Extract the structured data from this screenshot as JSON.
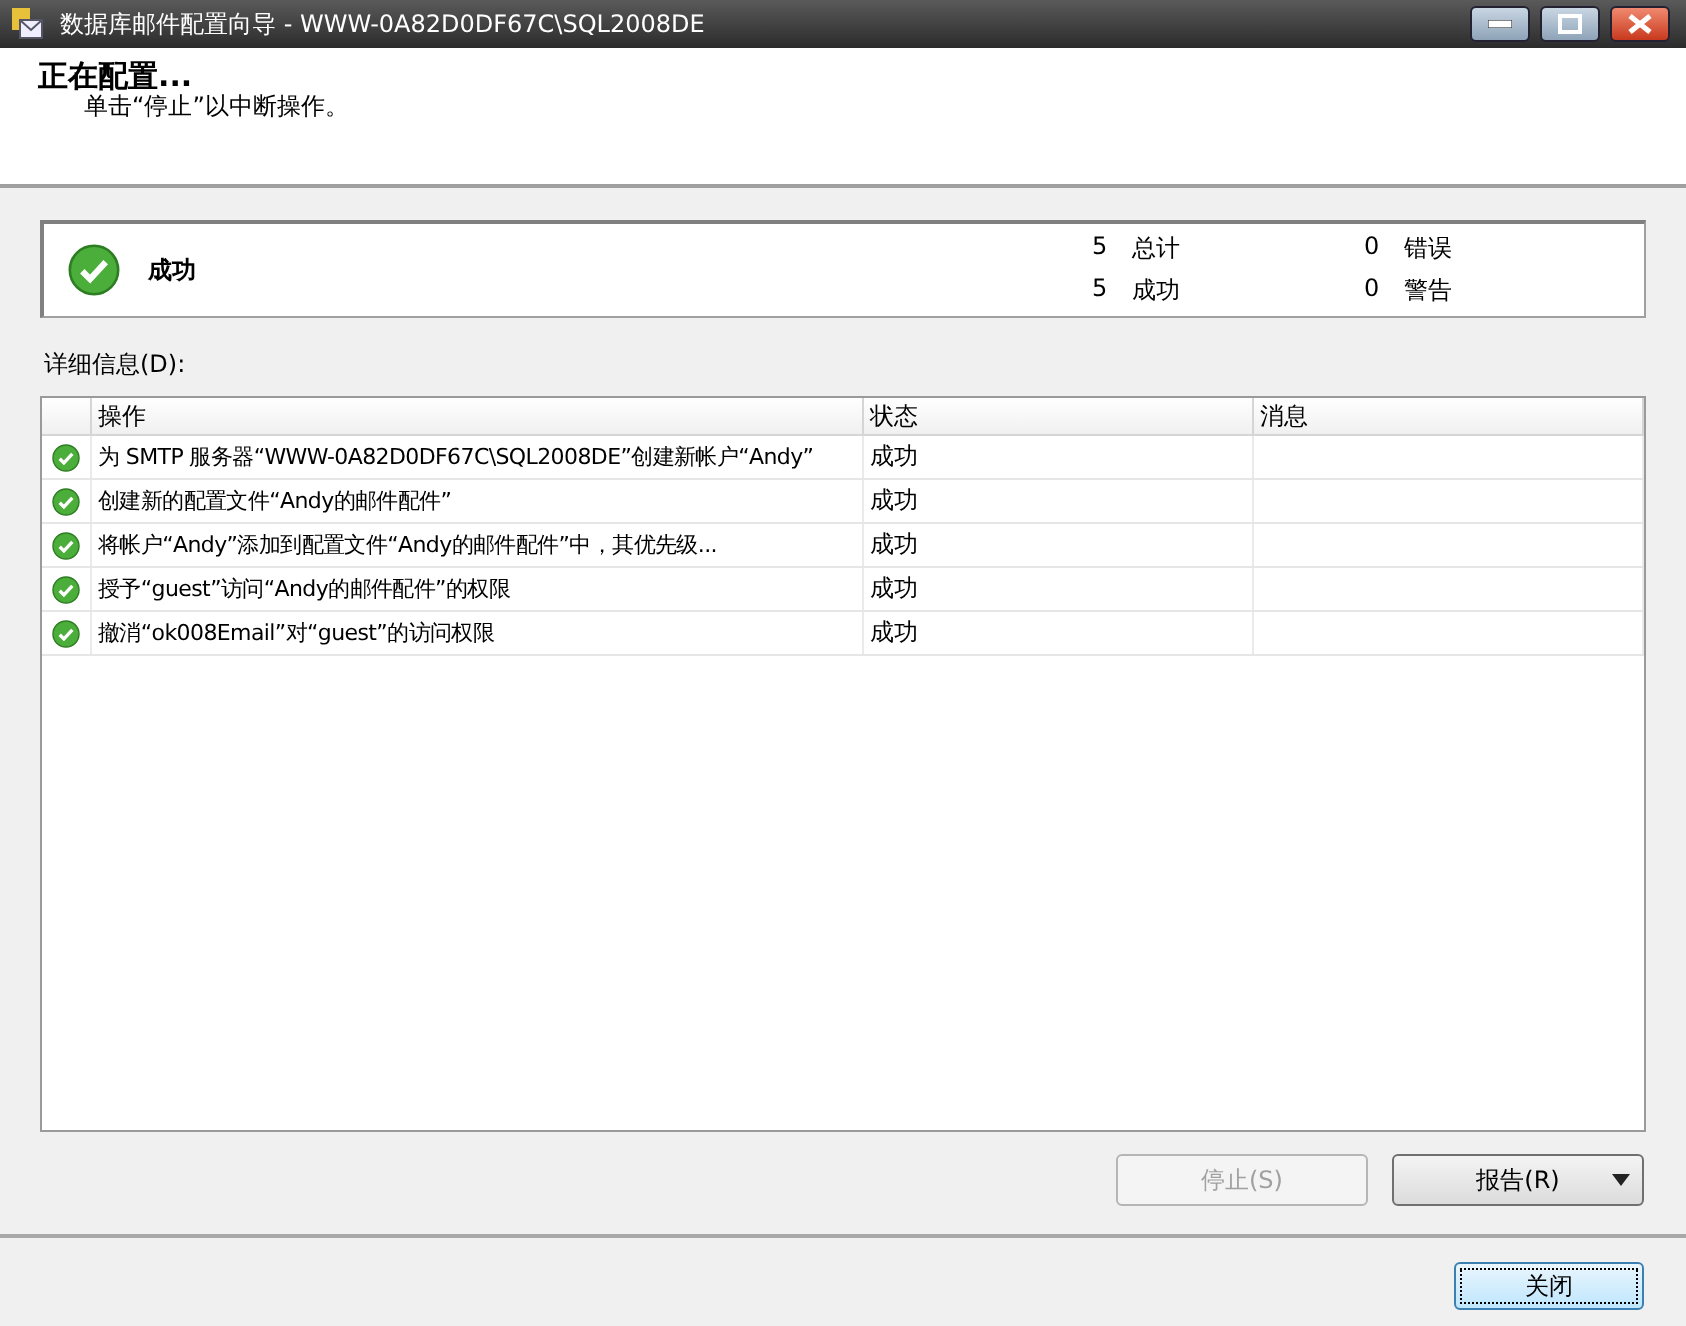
{
  "window": {
    "title": "数据库邮件配置向导 - WWW-0A82D0DF67C\\SQL2008DE"
  },
  "header": {
    "title": "正在配置...",
    "subtitle": "单击“停止”以中断操作。"
  },
  "summary": {
    "status": "成功",
    "stats": [
      {
        "value": "5",
        "label": "总计"
      },
      {
        "value": "0",
        "label": "错误"
      },
      {
        "value": "5",
        "label": "成功"
      },
      {
        "value": "0",
        "label": "警告"
      }
    ]
  },
  "details": {
    "label": "详细信息(D):",
    "columns": [
      "操作",
      "状态",
      "消息"
    ],
    "rows": [
      {
        "action": "为 SMTP 服务器“WWW-0A82D0DF67C\\SQL2008DE”创建新帐户“Andy”",
        "status": "成功"
      },
      {
        "action": "创建新的配置文件“Andy的邮件配件”",
        "status": "成功"
      },
      {
        "action": "将帐户“Andy”添加到配置文件“Andy的邮件配件”中，其优先级...",
        "status": "成功"
      },
      {
        "action": "授予“guest”访问“Andy的邮件配件”的权限",
        "status": "成功"
      },
      {
        "action": "撤消“ok008Email”对“guest”的访问权限",
        "status": "成功"
      }
    ]
  },
  "buttons": [
    {
      "label": "停止(S)",
      "kind": "plain",
      "disabled": true
    },
    {
      "label": "报告(R)",
      "kind": "dropdown",
      "disabled": false
    }
  ],
  "footer_button": {
    "label": "关闭"
  }
}
